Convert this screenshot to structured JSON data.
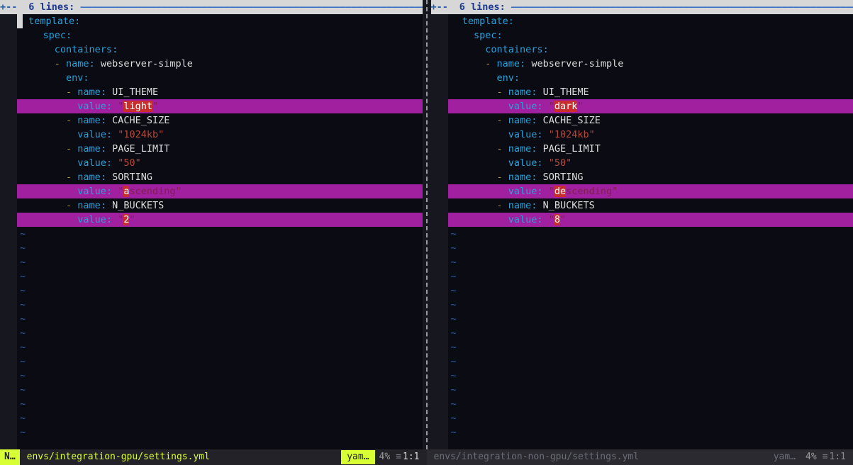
{
  "fold": {
    "marker": "+--",
    "count_label": "6 lines:",
    "dash_fill": "———————————————————————————————————————————————————————————————————"
  },
  "left": {
    "lines": [
      {
        "indent": "  ",
        "key": "template",
        "colon": ":"
      },
      {
        "indent": "    ",
        "key": "spec",
        "colon": ":"
      },
      {
        "indent": "      ",
        "key": "containers",
        "colon": ":"
      },
      {
        "indent": "      ",
        "dash": "- ",
        "key": "name",
        "colon": ": ",
        "value_plain": "webserver-simple"
      },
      {
        "indent": "        ",
        "key": "env",
        "colon": ":"
      },
      {
        "indent": "        ",
        "dash": "- ",
        "key": "name",
        "colon": ": ",
        "value_plain": "UI_THEME"
      },
      {
        "diff": true,
        "indent": "          ",
        "key": "value",
        "colon": ": ",
        "q1": "\"",
        "changed": "light",
        "same_after": "",
        "q2": "\""
      },
      {
        "indent": "        ",
        "dash": "- ",
        "key": "name",
        "colon": ": ",
        "value_plain": "CACHE_SIZE"
      },
      {
        "indent": "          ",
        "key": "value",
        "colon": ": ",
        "value_str": "\"1024kb\""
      },
      {
        "indent": "        ",
        "dash": "- ",
        "key": "name",
        "colon": ": ",
        "value_plain": "PAGE_LIMIT"
      },
      {
        "indent": "          ",
        "key": "value",
        "colon": ": ",
        "value_str": "\"50\""
      },
      {
        "indent": "        ",
        "dash": "- ",
        "key": "name",
        "colon": ": ",
        "value_plain": "SORTING"
      },
      {
        "diff": true,
        "indent": "          ",
        "key": "value",
        "colon": ": ",
        "q1": "\"",
        "changed": "a",
        "same_after": "scending",
        "q2": "\""
      },
      {
        "indent": "        ",
        "dash": "- ",
        "key": "name",
        "colon": ": ",
        "value_plain": "N_BUCKETS"
      },
      {
        "diff": true,
        "indent": "          ",
        "key": "value",
        "colon": ": ",
        "q1": "\"",
        "changed": "2",
        "same_after": "",
        "q2": "\""
      }
    ],
    "status": {
      "mode": "N…",
      "file": "envs/integration-gpu/settings.yml",
      "type": "yam…",
      "pct": "4%",
      "sep": "≡",
      "pos": "1:1"
    }
  },
  "right": {
    "lines": [
      {
        "indent": "  ",
        "key": "template",
        "colon": ":"
      },
      {
        "indent": "    ",
        "key": "spec",
        "colon": ":"
      },
      {
        "indent": "      ",
        "key": "containers",
        "colon": ":"
      },
      {
        "indent": "      ",
        "dash": "- ",
        "key": "name",
        "colon": ": ",
        "value_plain": "webserver-simple"
      },
      {
        "indent": "        ",
        "key": "env",
        "colon": ":"
      },
      {
        "indent": "        ",
        "dash": "- ",
        "key": "name",
        "colon": ": ",
        "value_plain": "UI_THEME"
      },
      {
        "diff": true,
        "indent": "          ",
        "key": "value",
        "colon": ": ",
        "q1": "\"",
        "changed": "dark",
        "same_after": "",
        "q2": "\""
      },
      {
        "indent": "        ",
        "dash": "- ",
        "key": "name",
        "colon": ": ",
        "value_plain": "CACHE_SIZE"
      },
      {
        "indent": "          ",
        "key": "value",
        "colon": ": ",
        "value_str": "\"1024kb\""
      },
      {
        "indent": "        ",
        "dash": "- ",
        "key": "name",
        "colon": ": ",
        "value_plain": "PAGE_LIMIT"
      },
      {
        "indent": "          ",
        "key": "value",
        "colon": ": ",
        "value_str": "\"50\""
      },
      {
        "indent": "        ",
        "dash": "- ",
        "key": "name",
        "colon": ": ",
        "value_plain": "SORTING"
      },
      {
        "diff": true,
        "indent": "          ",
        "key": "value",
        "colon": ": ",
        "q1": "\"",
        "changed": "de",
        "same_after": "scending",
        "q2": "\""
      },
      {
        "indent": "        ",
        "dash": "- ",
        "key": "name",
        "colon": ": ",
        "value_plain": "N_BUCKETS"
      },
      {
        "diff": true,
        "indent": "          ",
        "key": "value",
        "colon": ": ",
        "q1": "\"",
        "changed": "8",
        "same_after": "",
        "q2": "\""
      }
    ],
    "status": {
      "file": "envs/integration-non-gpu/settings.yml",
      "type": "yam…",
      "pct": "4%",
      "sep": "≡",
      "pos": "1:1"
    }
  },
  "tilde": "~",
  "tilde_count": 15
}
